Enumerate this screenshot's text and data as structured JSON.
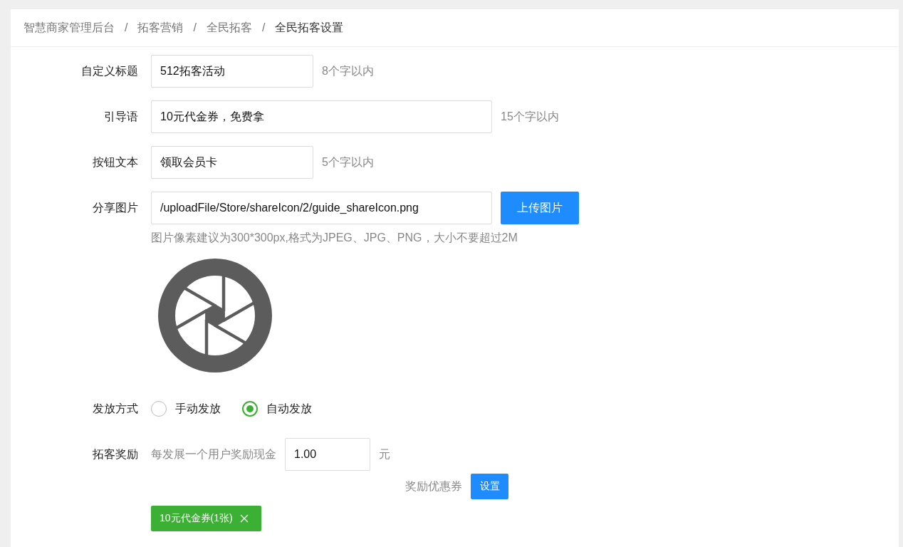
{
  "breadcrumb": [
    {
      "label": "智慧商家管理后台",
      "current": false
    },
    {
      "label": "拓客营销",
      "current": false
    },
    {
      "label": "全民拓客",
      "current": false
    },
    {
      "label": "全民拓客设置",
      "current": true
    }
  ],
  "breadcrumb_separator": "/",
  "form": {
    "title_field": {
      "label": "自定义标题",
      "value": "512拓客活动",
      "hint": "8个字以内"
    },
    "guide_field": {
      "label": "引导语",
      "value": "10元代金券，免费拿",
      "hint": "15个字以内"
    },
    "button_text_field": {
      "label": "按钮文本",
      "value": "领取会员卡",
      "hint": "5个字以内"
    },
    "share_image": {
      "label": "分享图片",
      "value": "/uploadFile/Store/shareIcon/2/guide_shareIcon.png",
      "upload_button": "上传图片",
      "note": "图片像素建议为300*300px,格式为JPEG、JPG、PNG，大小不要超过2M"
    },
    "distribution": {
      "label": "发放方式",
      "options": [
        {
          "label": "手动发放",
          "selected": false
        },
        {
          "label": "自动发放",
          "selected": true
        }
      ]
    },
    "reward": {
      "label": "拓客奖励",
      "prefix": "每发展一个用户奖励现金",
      "value": "1.00",
      "unit": "元",
      "coupon_label": "奖励优惠券",
      "coupon_button": "设置",
      "coupons": [
        {
          "label": "10元代金券(1张)"
        }
      ]
    }
  }
}
